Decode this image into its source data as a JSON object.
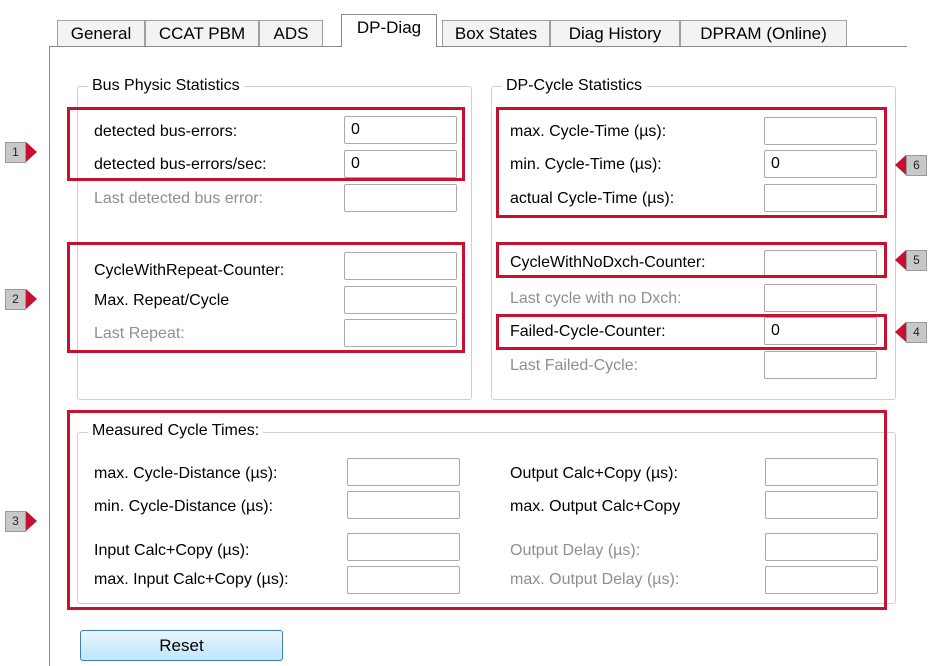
{
  "tabs": [
    {
      "label": "General"
    },
    {
      "label": "CCAT PBM"
    },
    {
      "label": "ADS"
    },
    {
      "label": "DP-Diag"
    },
    {
      "label": "Box States"
    },
    {
      "label": "Diag History"
    },
    {
      "label": "DPRAM (Online)"
    }
  ],
  "bus_physic": {
    "title": "Bus Physic Statistics",
    "detected_errors_label": "detected bus-errors:",
    "detected_errors_value": "0",
    "errors_per_sec_label": "detected bus-errors/sec:",
    "errors_per_sec_value": "0",
    "last_error_label": "Last detected bus error:",
    "last_error_value": "",
    "repeat_counter_label": "CycleWithRepeat-Counter:",
    "repeat_counter_value": "",
    "max_repeat_label": "Max. Repeat/Cycle",
    "max_repeat_value": "",
    "last_repeat_label": "Last Repeat:",
    "last_repeat_value": ""
  },
  "dp_cycle": {
    "title": "DP-Cycle Statistics",
    "max_cycle_label": "max. Cycle-Time (µs):",
    "max_cycle_value": "",
    "min_cycle_label": "min. Cycle-Time (µs):",
    "min_cycle_value": "0",
    "actual_cycle_label": "actual Cycle-Time (µs):",
    "actual_cycle_value": "",
    "nodxch_counter_label": "CycleWithNoDxch-Counter:",
    "nodxch_counter_value": "",
    "last_nodxch_label": "Last cycle with no Dxch:",
    "last_nodxch_value": "",
    "failed_counter_label": "Failed-Cycle-Counter:",
    "failed_counter_value": "0",
    "last_failed_label": "Last Failed-Cycle:",
    "last_failed_value": ""
  },
  "measured": {
    "title": "Measured Cycle Times:",
    "max_distance_label": "max. Cycle-Distance (µs):",
    "max_distance_value": "",
    "min_distance_label": "min. Cycle-Distance (µs):",
    "min_distance_value": "",
    "input_calc_label": "Input Calc+Copy (µs):",
    "input_calc_value": "",
    "max_input_calc_label": "max. Input Calc+Copy (µs):",
    "max_input_calc_value": "",
    "output_calc_label": "Output Calc+Copy (µs):",
    "output_calc_value": "",
    "max_output_calc_label": "max. Output Calc+Copy",
    "max_output_calc_value": "",
    "output_delay_label": "Output Delay (µs):",
    "output_delay_value": "",
    "max_output_delay_label": "max. Output Delay (µs):",
    "max_output_delay_value": ""
  },
  "reset_label": "Reset",
  "callouts": [
    "1",
    "2",
    "3",
    "4",
    "5",
    "6"
  ],
  "colors": {
    "highlight": "#c41230",
    "disabled_text": "#8f8f8f",
    "button_border": "#3c7fb1"
  }
}
